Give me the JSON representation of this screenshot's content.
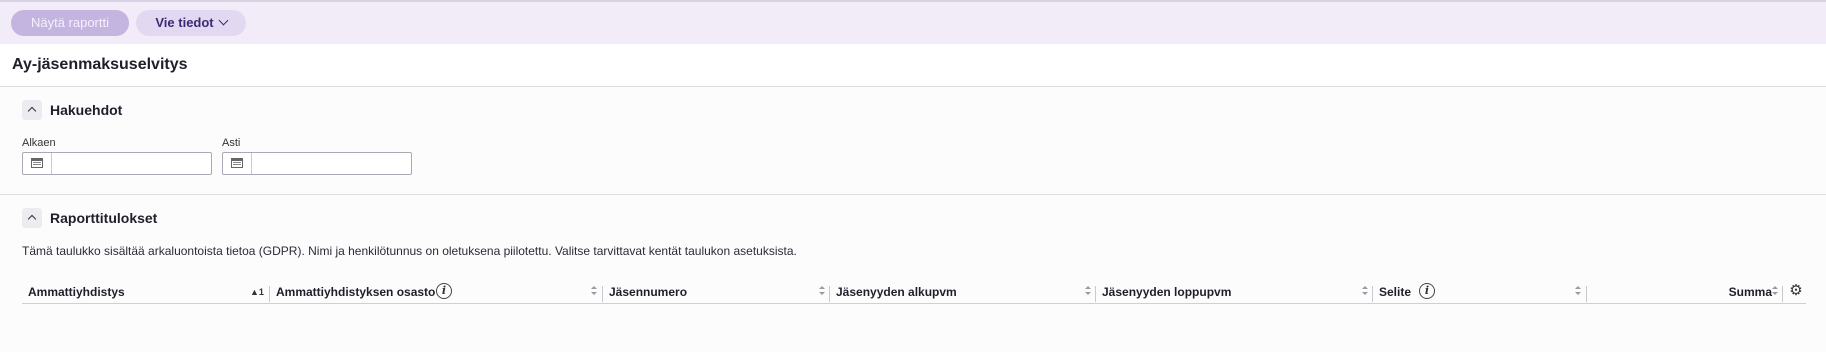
{
  "toolbar": {
    "show_report_label": "Näytä raportti",
    "export_label": "Vie tiedot"
  },
  "page": {
    "title": "Ay-jäsenmaksuselvitys"
  },
  "search": {
    "title": "Hakuehdot",
    "from_label": "Alkaen",
    "to_label": "Asti",
    "from_value": "",
    "to_value": ""
  },
  "results": {
    "title": "Raporttitulokset",
    "notice": "Tämä taulukko sisältää arkaluontoista tietoa (GDPR). Nimi ja henkilötunnus on oletuksena piilotettu. Valitse tarvittavat kentät taulukon asetuksista.",
    "columns": [
      "Ammattiyhdistys",
      "Ammattiyhdistyksen osasto",
      "Jäsennumero",
      "Jäsenyyden alkupvm",
      "Jäsenyyden loppupvm",
      "Selite",
      "Summa"
    ],
    "sort_indicator": "▲1"
  },
  "icons": {
    "export_chevron": "chevron-down-icon",
    "collapse": "chevron-up-icon",
    "calendar": "calendar-icon",
    "info": "info-icon",
    "settings": "gear-icon",
    "sort": "sort-icon"
  },
  "colors": {
    "topbar_bg": "#f2ecf8",
    "primary_button": "#c4b4e0",
    "secondary_button": "#e3d8f2",
    "accent_text": "#3e2b74"
  }
}
